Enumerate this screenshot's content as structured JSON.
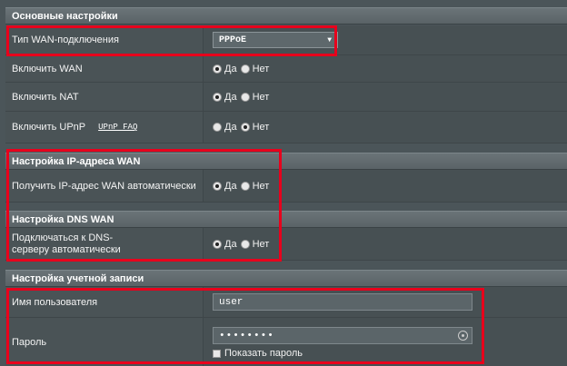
{
  "basic": {
    "header": "Основные настройки",
    "wan_type_label": "Тип WAN-подключения",
    "wan_type_value": "PPPoE",
    "enable_wan_label": "Включить WAN",
    "enable_nat_label": "Включить NAT",
    "enable_upnp_label": "Включить UPnP",
    "upnp_faq": "UPnP FAQ"
  },
  "radio": {
    "yes": "Да",
    "no": "Нет"
  },
  "ip": {
    "header": "Настройка IP-адреса WAN",
    "auto_ip_label": "Получить IP-адрес WAN автоматически"
  },
  "dns": {
    "header": "Настройка DNS WAN",
    "auto_dns_label": "Подключаться к DNS-серверу автоматически"
  },
  "account": {
    "header": "Настройка учетной записи",
    "username_label": "Имя пользователя",
    "username_value": "user",
    "password_label": "Пароль",
    "password_value": "••••••••",
    "show_password_label": "Показать пароль"
  },
  "colors": {
    "highlight": "#e8001c",
    "background": "#4b5559"
  }
}
